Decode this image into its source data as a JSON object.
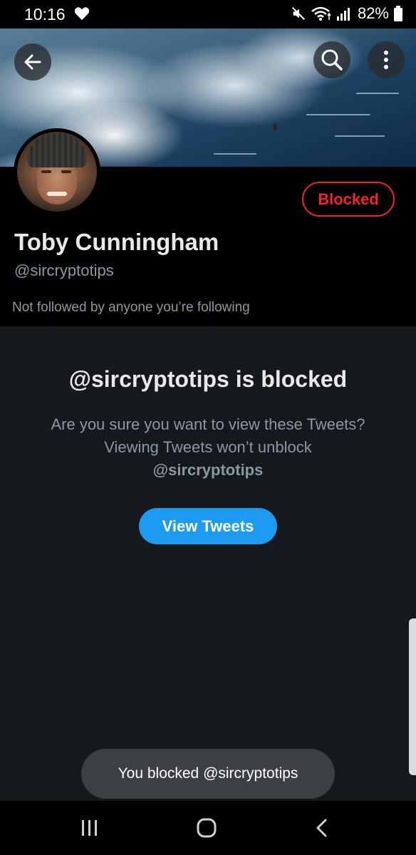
{
  "status_bar": {
    "time": "10:16",
    "battery_percent": "82%"
  },
  "header": {
    "back_icon": "arrow-left-icon",
    "search_icon": "search-icon",
    "more_icon": "more-vertical-icon"
  },
  "profile": {
    "display_name": "Toby Cunningham",
    "handle": "@sircryptotips",
    "blocked_button_label": "Blocked",
    "followed_by_text": "Not followed by anyone you’re following"
  },
  "blocked_notice": {
    "title": "@sircryptotips is blocked",
    "message": "Are you sure you want to view these Tweets? Viewing Tweets won’t unblock",
    "message_handle": "@sircryptotips",
    "view_button_label": "View Tweets"
  },
  "toast": {
    "text": "You blocked @sircryptotips"
  },
  "colors": {
    "accent_blue": "#1d9bf0",
    "blocked_red": "#f4212e",
    "background": "#15181c",
    "secondary_text": "#8b98a5"
  }
}
